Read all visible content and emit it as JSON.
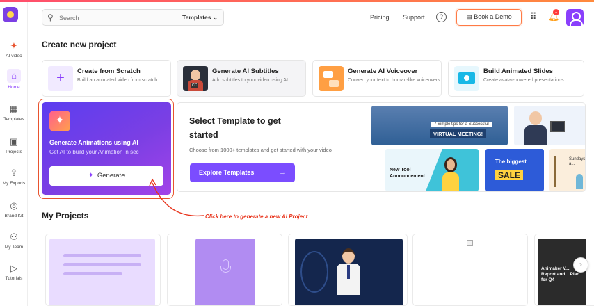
{
  "header": {
    "search_placeholder": "Search",
    "search_filter": "Templates",
    "pricing": "Pricing",
    "support": "Support",
    "help_glyph": "?",
    "book_demo": "Book a Demo",
    "notification_count": "1"
  },
  "sidebar": {
    "items": [
      {
        "label": "AI video",
        "icon": "ai-video-icon"
      },
      {
        "label": "Home",
        "icon": "home-icon"
      },
      {
        "label": "Templates",
        "icon": "templates-icon"
      },
      {
        "label": "Projects",
        "icon": "projects-icon"
      },
      {
        "label": "My Exports",
        "icon": "exports-icon"
      },
      {
        "label": "Brand Kit",
        "icon": "brand-kit-icon"
      },
      {
        "label": "My Team",
        "icon": "team-icon"
      },
      {
        "label": "Tutorials",
        "icon": "tutorials-icon"
      }
    ]
  },
  "create_new": {
    "title": "Create new project",
    "cards": [
      {
        "title": "Create from Scratch",
        "desc": "Build an animated video from scratch"
      },
      {
        "title": "Generate AI Subtitles",
        "desc": "Add subtitles to your video using AI"
      },
      {
        "title": "Generate AI Voiceover",
        "desc": "Convert your text to human-like voiceovers"
      },
      {
        "title": "Build Animated Slides",
        "desc": "Create avatar-powered presentations"
      }
    ]
  },
  "ai_card": {
    "title": "Generate Animations using AI",
    "desc": "Get AI to build your Animation in sec",
    "button": "Generate"
  },
  "template_card": {
    "title": "Select Template to get started",
    "desc": "Choose from 1000+ templates and get started with your video",
    "button": "Explore Templates",
    "thumbs": {
      "vm_tag": "7 Simple tips for a Successful",
      "vm_title": "VIRTUAL MEETING!",
      "new_tool": "New Tool Announcement",
      "sale_top": "The biggest",
      "sale": "SALE",
      "beach": "Sundays a..."
    }
  },
  "annotation": "Click here to generate a new AI Project",
  "my_projects": {
    "title": "My Projects",
    "p5_text": "Animaker V... Report and... Plan for Q4"
  },
  "colors": {
    "accent": "#8a3ffc",
    "annotation": "#e8341c",
    "explore": "#7b4dff"
  }
}
